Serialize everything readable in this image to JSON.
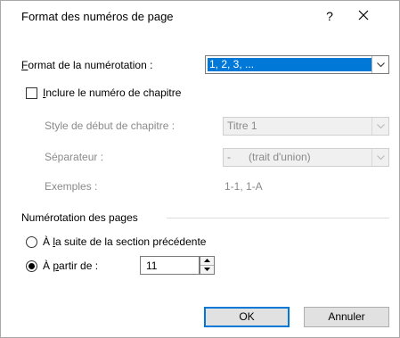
{
  "window": {
    "title": "Format des numéros de page",
    "help": "?"
  },
  "format": {
    "label_accel": "F",
    "label_rest": "ormat de la numérotation :",
    "value": "1, 2, 3, ..."
  },
  "chapter": {
    "include_checked": false,
    "include_accel": "I",
    "include_rest": "nclure le numéro de chapitre",
    "style_label": "Style de début de chapitre :",
    "style_value": "Titre 1",
    "separator_label": "Séparateur :",
    "separator_value": "-      (trait d'union)",
    "examples_label": "Exemples :",
    "examples_value": "1-1, 1-A"
  },
  "numbering": {
    "group_label": "Numérotation des pages",
    "continue_pre": "À ",
    "continue_accel": "l",
    "continue_rest": "a suite de la section précédente",
    "continue_selected": false,
    "start_pre": "À ",
    "start_accel": "p",
    "start_rest": "artir de :",
    "start_selected": true,
    "start_value": "11"
  },
  "buttons": {
    "ok": "OK",
    "cancel": "Annuler"
  },
  "colors": {
    "accent": "#0078d7",
    "disabled_text": "#8a8a8a"
  }
}
